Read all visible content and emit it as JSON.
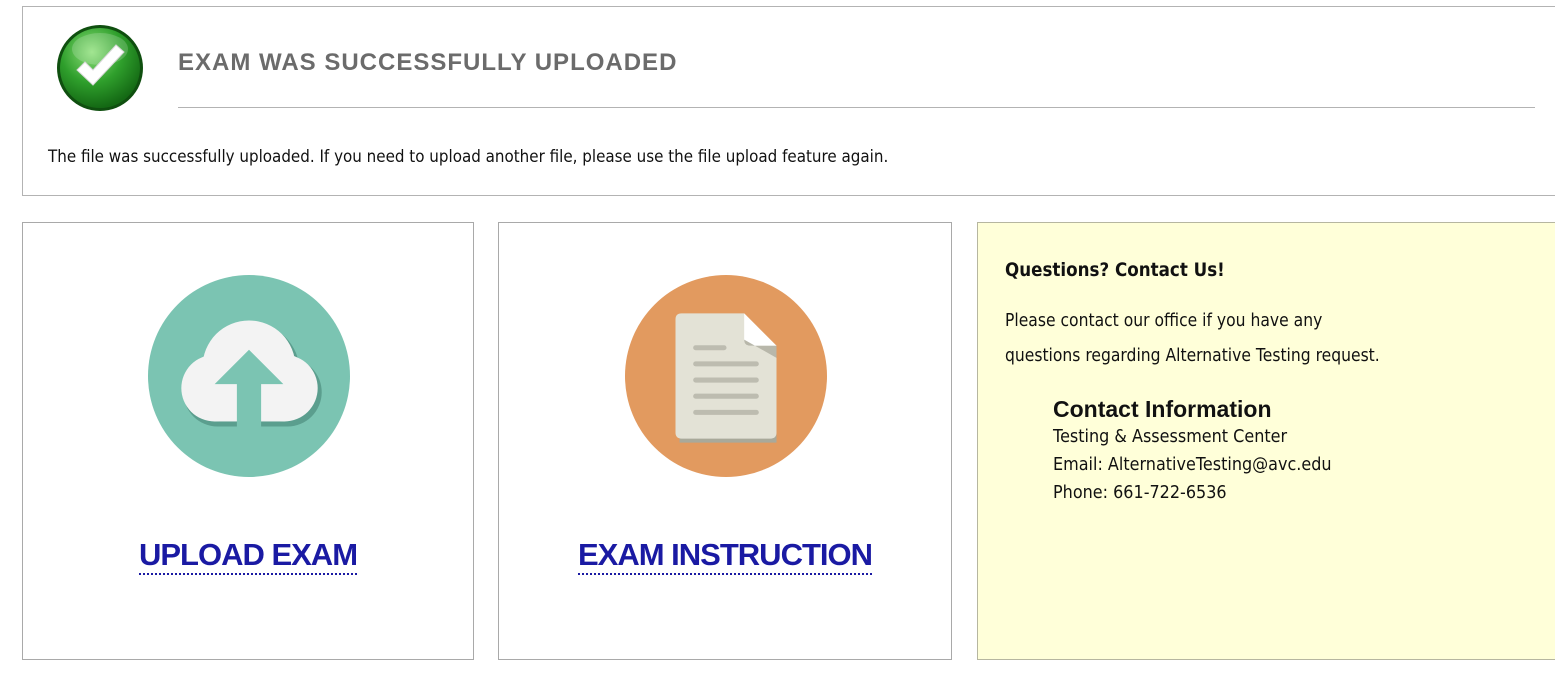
{
  "banner": {
    "title": "EXAM WAS SUCCESSFULLY UPLOADED",
    "message": "The file was successfully uploaded. If you need to upload another file, please use the file upload feature again.",
    "icon": "check-circle-icon"
  },
  "tiles": [
    {
      "label": "UPLOAD EXAM",
      "icon": "cloud-upload-icon",
      "icon_color": "#7bc4b2"
    },
    {
      "label": "EXAM INSTRUCTION",
      "icon": "document-icon",
      "icon_color": "#e29a5f"
    }
  ],
  "contact": {
    "heading": "Questions? Contact Us!",
    "text_line1": "Please contact our office if you have any",
    "text_line2": "questions regarding Alternative Testing request.",
    "info_title": "Contact Information",
    "office": "Testing & Assessment Center",
    "email": "Email: AlternativeTesting@avc.edu",
    "phone": "Phone: 661-722-6536",
    "background": "#ffffd9"
  },
  "colors": {
    "link": "#1a1aa3",
    "title_gray": "#6b6b6b",
    "success_green": "#2e9a2e"
  }
}
